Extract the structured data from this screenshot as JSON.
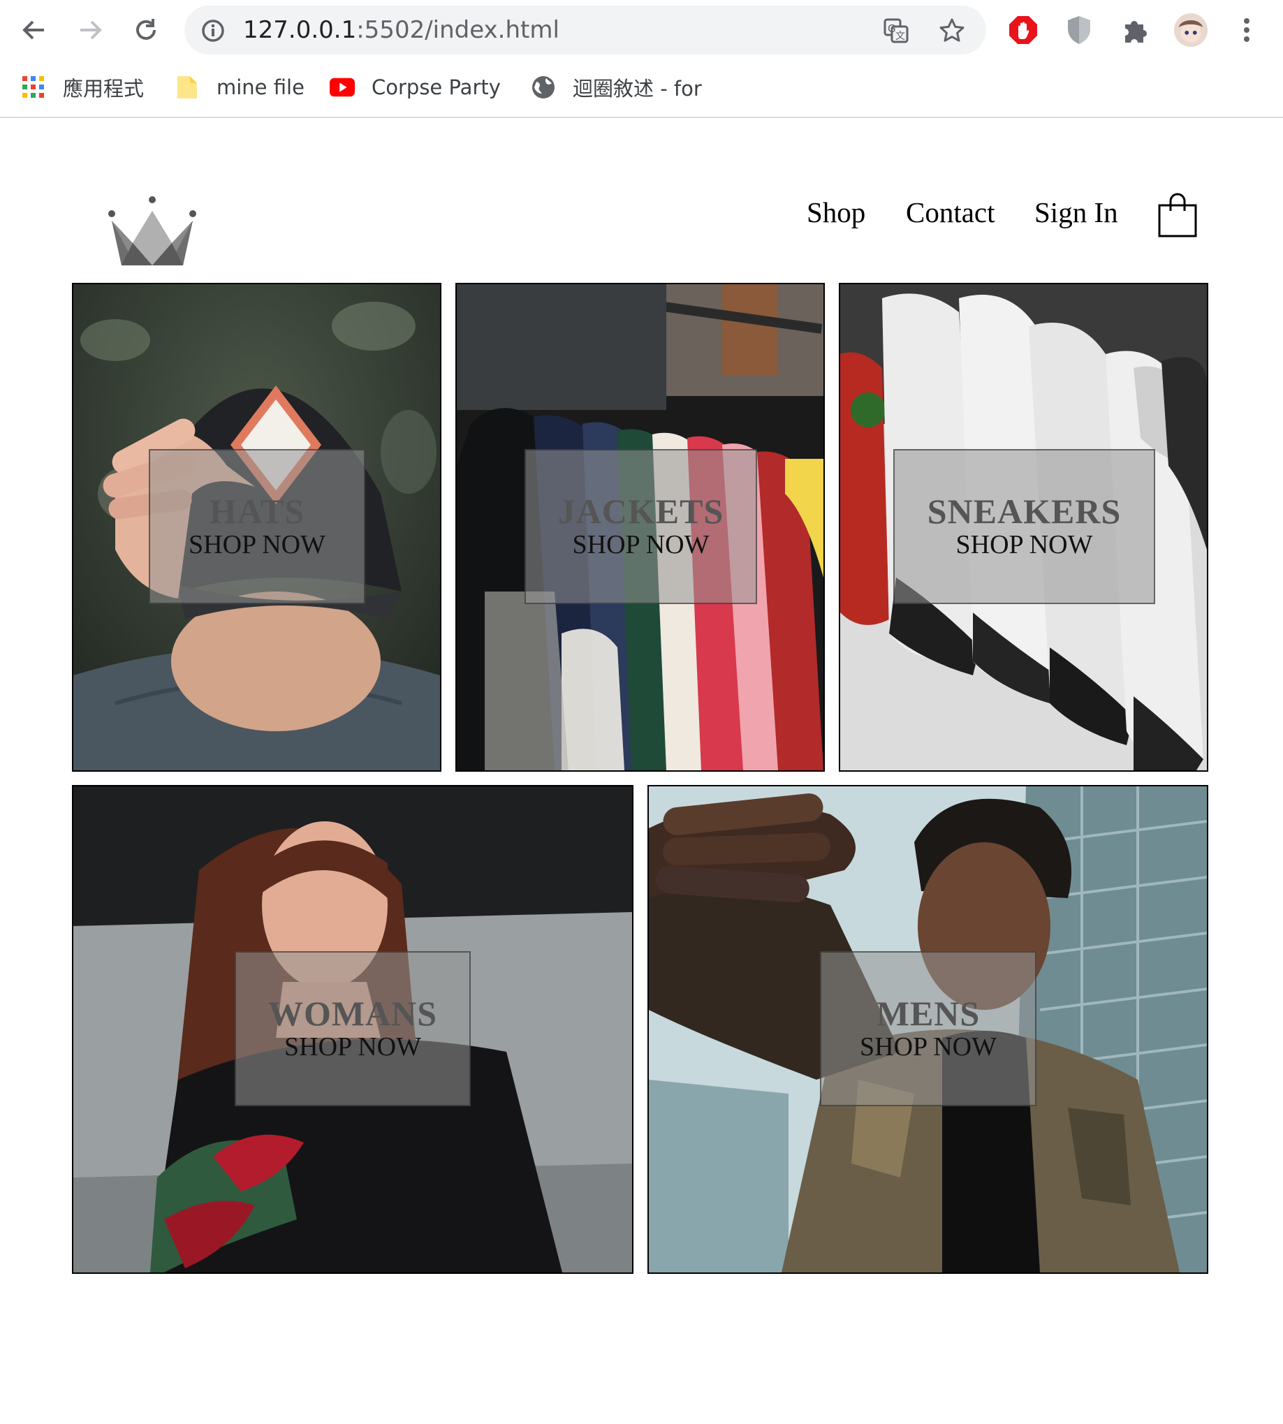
{
  "browser": {
    "url_host": "127.0.0.1",
    "url_path": ":5502/index.html",
    "bookmarks": [
      {
        "label": "應用程式",
        "icon": "apps-grid-icon"
      },
      {
        "label": "mine file",
        "icon": "folder-icon"
      },
      {
        "label": "Corpse Party",
        "icon": "youtube-icon"
      },
      {
        "label": "迴圈敘述 - for",
        "icon": "globe-icon"
      }
    ]
  },
  "header": {
    "logo": "crown-logo",
    "nav": [
      "Shop",
      "Contact",
      "Sign In"
    ],
    "cart_icon": "shopping-bag-icon"
  },
  "collections": [
    {
      "title": "HATS",
      "cta": "SHOP NOW"
    },
    {
      "title": "JACKETS",
      "cta": "SHOP NOW"
    },
    {
      "title": "SNEAKERS",
      "cta": "SHOP NOW"
    },
    {
      "title": "WOMANS",
      "cta": "SHOP NOW"
    },
    {
      "title": "MENS",
      "cta": "SHOP NOW"
    }
  ],
  "colors": {
    "chrome_bg": "#ffffff",
    "omnibox_bg": "#f1f3f4",
    "caption_overlay": "#969696",
    "text": "#000000"
  }
}
